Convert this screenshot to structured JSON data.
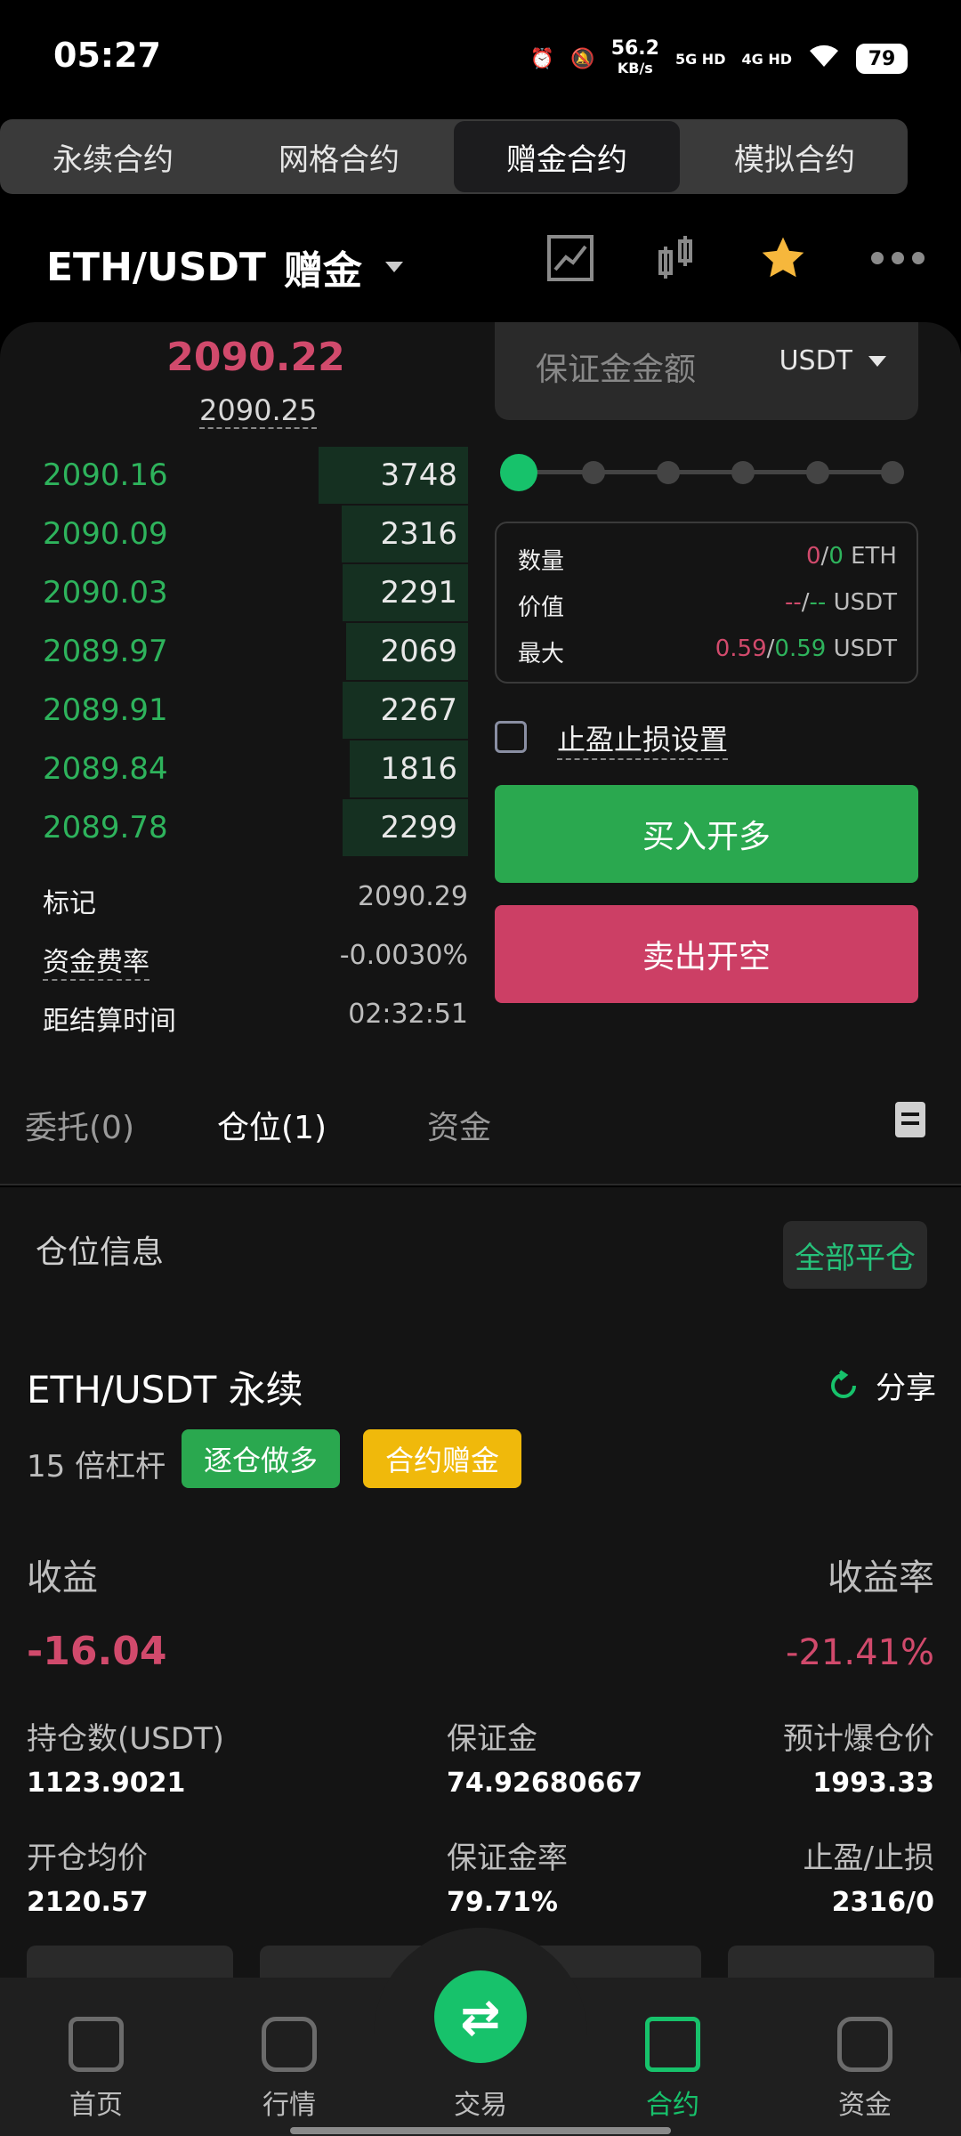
{
  "status_bar": {
    "time": "05:27",
    "net_speed": "56.2",
    "net_unit": "KB/s",
    "sig1": "5G HD",
    "sig2": "4G HD",
    "battery": "79"
  },
  "tabs": [
    {
      "label": "永续合约",
      "active": false
    },
    {
      "label": "网格合约",
      "active": false
    },
    {
      "label": "赠金合约",
      "active": true
    },
    {
      "label": "模拟合约",
      "active": false
    }
  ],
  "header": {
    "pair": "ETH/USDT",
    "tag": "赠金"
  },
  "orderbook": {
    "last_price": "2090.22",
    "mark_price": "2090.25",
    "rows": [
      {
        "price": "2090.16",
        "size": "3748",
        "depth": 1.0
      },
      {
        "price": "2090.09",
        "size": "2316",
        "depth": 0.62
      },
      {
        "price": "2090.03",
        "size": "2291",
        "depth": 0.61
      },
      {
        "price": "2089.97",
        "size": "2069",
        "depth": 0.55
      },
      {
        "price": "2089.91",
        "size": "2267",
        "depth": 0.6
      },
      {
        "price": "2089.84",
        "size": "1816",
        "depth": 0.48
      },
      {
        "price": "2089.78",
        "size": "2299",
        "depth": 0.61
      }
    ],
    "mark_label": "标记",
    "mark_value": "2090.29",
    "funding_label": "资金费率",
    "funding_value": "-0.0030%",
    "settle_label": "距结算时间",
    "settle_value": "02:32:51"
  },
  "form": {
    "margin_placeholder": "保证金金额",
    "margin_unit": "USDT",
    "qty_label": "数量",
    "qty_a": "0",
    "qty_sep": "/",
    "qty_b": "0",
    "qty_unit": "ETH",
    "value_label": "价值",
    "value_a": "--",
    "value_sep": "/",
    "value_b": "--",
    "value_unit": "USDT",
    "max_label": "最大",
    "max_a": "0.59",
    "max_sep": "/",
    "max_b": "0.59",
    "max_unit": "USDT",
    "tpsl_label": "止盈止损设置",
    "buy_label": "买入开多",
    "sell_label": "卖出开空"
  },
  "position_tabs": {
    "orders": "委托(0)",
    "positions": "仓位(1)",
    "funds": "资金"
  },
  "position": {
    "section_label": "仓位信息",
    "close_all": "全部平仓",
    "pair": "ETH/USDT 永续",
    "share": "分享",
    "leverage": "15 倍杠杆",
    "tag_isolated": "逐仓做多",
    "tag_bonus": "合约赠金",
    "pnl_label": "收益",
    "roi_label": "收益率",
    "pnl_value": "-16.04",
    "roi_value": "-21.41%",
    "size_label": "持仓数(USDT)",
    "size_value": "1123.9021",
    "margin_label": "保证金",
    "margin_value": "74.92680667",
    "liq_label": "预计爆仓价",
    "liq_value": "1993.33",
    "entry_label": "开仓均价",
    "entry_value": "2120.57",
    "margin_rate_label": "保证金率",
    "margin_rate_value": "79.71%",
    "tpsl_label": "止盈/止损",
    "tpsl_value": "2316/0"
  },
  "nav": [
    {
      "label": "首页",
      "icon": "home-icon",
      "active": false
    },
    {
      "label": "行情",
      "icon": "market-icon",
      "active": false
    },
    {
      "label": "交易",
      "icon": "swap-icon",
      "active": false
    },
    {
      "label": "合约",
      "icon": "contract-icon",
      "active": true
    },
    {
      "label": "资金",
      "icon": "wallet-icon",
      "active": false
    }
  ],
  "colors": {
    "green": "#2eb35c",
    "red": "#d14a6c",
    "accent": "#17c26b",
    "bonus": "#f0b90b"
  }
}
